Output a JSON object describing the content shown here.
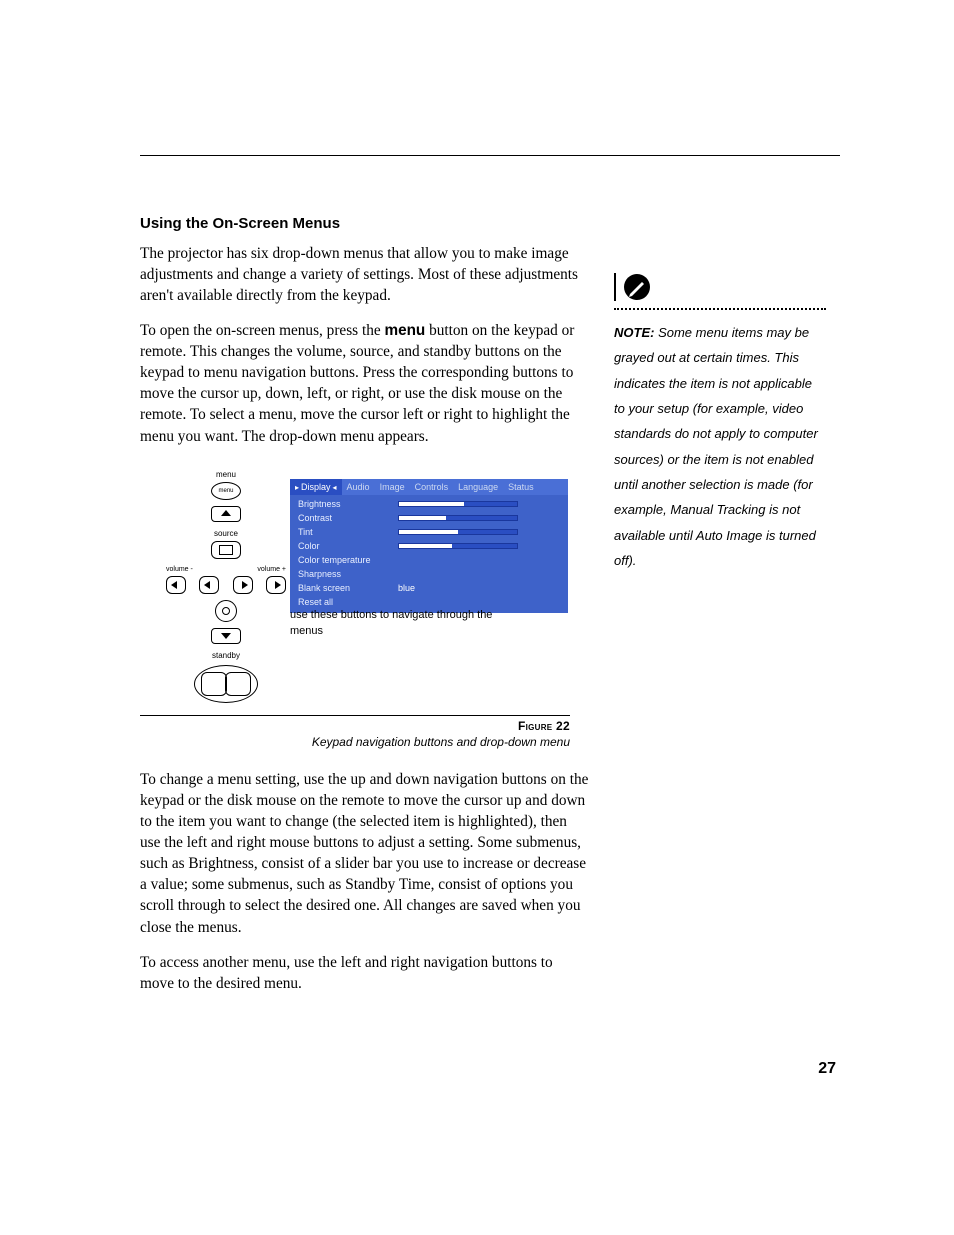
{
  "heading": "Using the On-Screen Menus",
  "para1": "The projector has six drop-down menus that allow you to make image adjustments and change a variety of settings. Most of these adjustments aren't available directly from the keypad.",
  "para2_a": "To open the on-screen menus, press the ",
  "para2_bold": "menu",
  "para2_b": " button on the keypad or remote. This changes the volume, source, and standby buttons on the keypad to menu navigation buttons. Press the corresponding buttons to move the cursor up, down, left, or right, or use the disk mouse on the remote. To select a menu, move the cursor left or right to highlight the menu you want. The drop-down menu appears.",
  "keypad": {
    "menu": "menu",
    "source": "source",
    "vol_minus": "volume -",
    "vol_plus": "volume +",
    "standby": "standby",
    "menu_btn_text": "menu"
  },
  "osd": {
    "tabs": [
      "Display",
      "Audio",
      "Image",
      "Controls",
      "Language",
      "Status"
    ],
    "active_tab": 0,
    "rows": [
      {
        "label": "Brightness",
        "bar": 55
      },
      {
        "label": "Contrast",
        "bar": 40
      },
      {
        "label": "Tint",
        "bar": 50
      },
      {
        "label": "Color",
        "bar": 45
      },
      {
        "label": "Color temperature"
      },
      {
        "label": "Sharpness"
      },
      {
        "label": "Blank screen",
        "value": "blue"
      },
      {
        "label": "Reset all"
      }
    ],
    "nav_note": "use these buttons to navigate through the menus"
  },
  "figure": {
    "label_word": "Figure",
    "number": "22",
    "caption": "Keypad navigation buttons and drop-down menu"
  },
  "para3": "To change a menu setting, use the up and down navigation buttons on the keypad or the disk mouse on the remote to move the cursor up and down to the item you want to change (the selected item is highlighted), then use the left and right mouse buttons to adjust a setting. Some submenus, such as Brightness, consist of a slider bar you use to increase or decrease a value; some submenus, such as Standby Time, consist of options you scroll through to select the desired one. All changes are saved when you close the menus.",
  "para4": "To access another menu, use the left and right navigation buttons to move to the desired menu.",
  "note": {
    "label": "NOTE:",
    "text": " Some menu items may be grayed out at certain times. This indicates the item is not applicable to your setup (for example, video standards do not apply to computer sources) or the item is not enabled until another selection is made (for example, Manual Tracking is not available until Auto Image is turned off)."
  },
  "page_number": "27"
}
